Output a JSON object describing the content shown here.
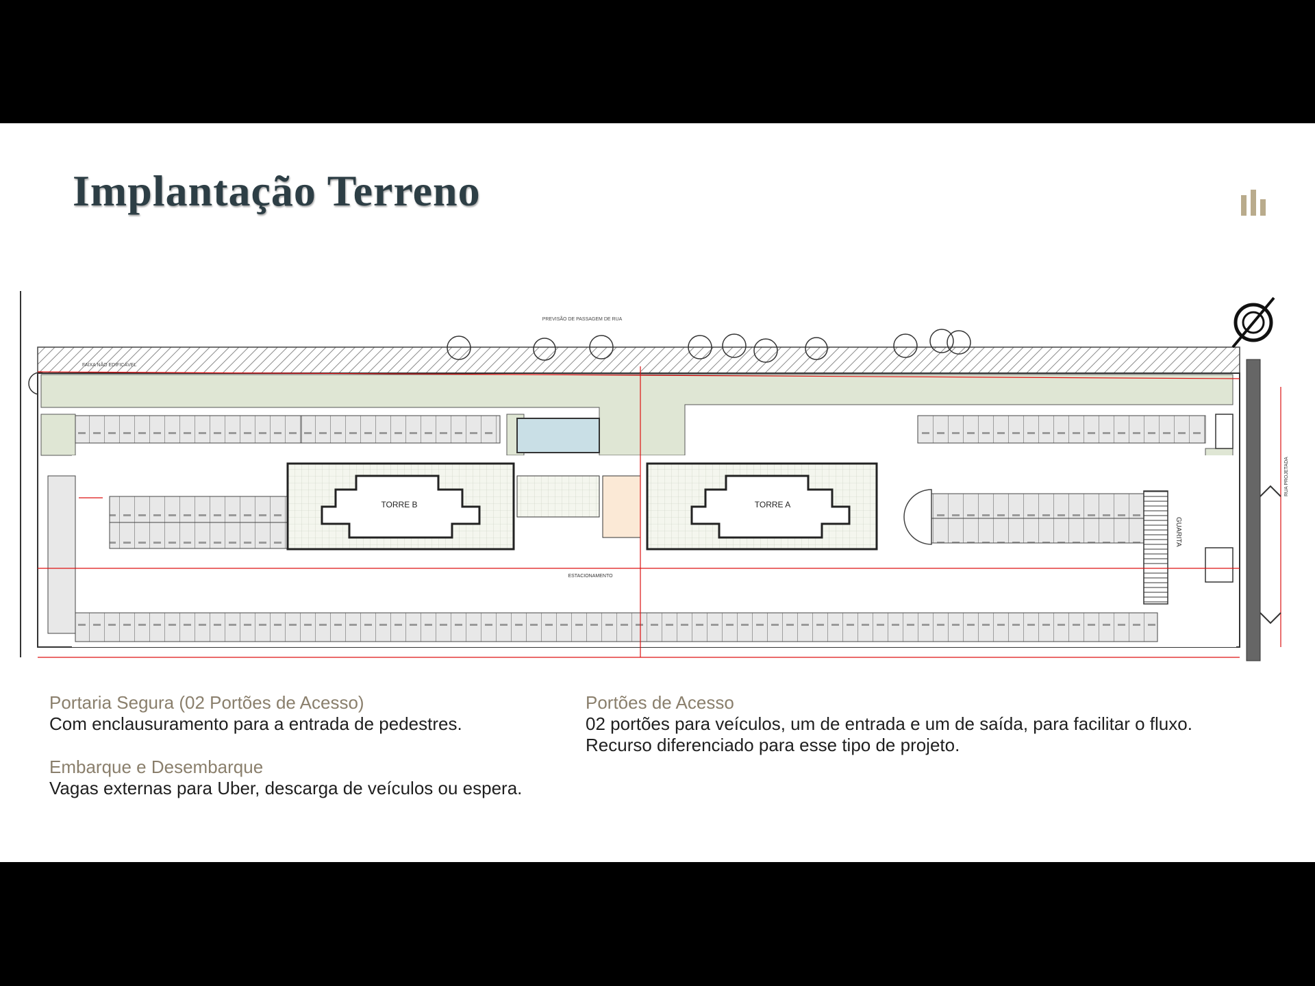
{
  "slide": {
    "title": "Implantação Terreno",
    "colors": {
      "title": "#2d3e45",
      "accent": "#8a7f6c",
      "logo": "#b9ab8c",
      "text": "#1f1f1f"
    }
  },
  "plan": {
    "street_note": "PREVISÃO DE PASSAGEM DE RUA",
    "setback_note": "FAIXA NÃO EDIFICÁVEL",
    "tower_a": "TORRE A",
    "tower_b": "TORRE B",
    "gatehouse": "GUARITA",
    "parking": "ESTACIONAMENTO",
    "side_street": "RUA PROJETADA"
  },
  "features": [
    {
      "heading": "Portaria Segura (02 Portões de Acesso)",
      "lines": [
        "Com enclausuramento para a entrada de pedestres."
      ]
    },
    {
      "heading": "Embarque e Desembarque",
      "lines": [
        "Vagas externas para Uber, descarga de veículos ou espera."
      ]
    },
    {
      "heading": "Portões de Acesso",
      "lines": [
        "02 portões para veículos, um de entrada e um de saída, para facilitar o fluxo.",
        "Recurso diferenciado para esse tipo de projeto."
      ]
    }
  ]
}
